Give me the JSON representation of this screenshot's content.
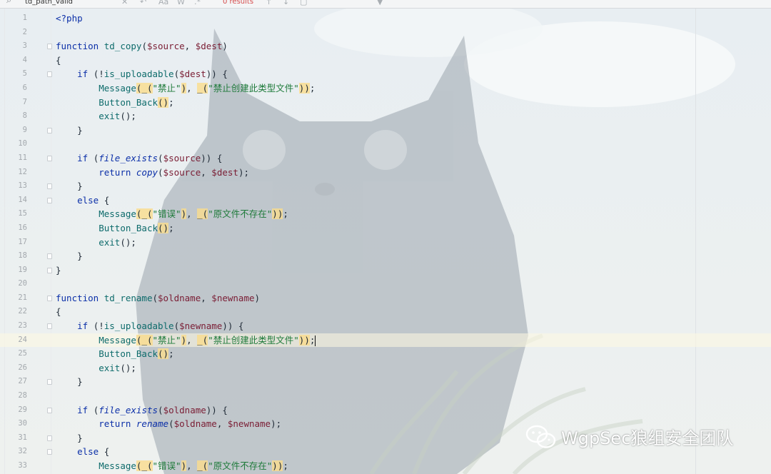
{
  "find_bar": {
    "query": "td_path_valid",
    "results_text": "0 results",
    "icons": [
      "search-icon",
      "close-icon",
      "undo-icon",
      "match-case-icon",
      "whole-word-icon",
      "regex-icon",
      "prev-result-icon",
      "next-result-icon",
      "select-all-icon",
      "filter-icon"
    ]
  },
  "editor": {
    "current_line": 24,
    "line_numbers": [
      "1",
      "2",
      "3",
      "4",
      "5",
      "6",
      "7",
      "8",
      "9",
      "10",
      "11",
      "12",
      "13",
      "14",
      "15",
      "16",
      "17",
      "18",
      "19",
      "20",
      "21",
      "22",
      "23",
      "24",
      "25",
      "26",
      "27",
      "28",
      "29",
      "30",
      "31",
      "32",
      "33"
    ],
    "lines": [
      "<?php",
      "",
      "function td_copy($source, $dest)",
      "{",
      "    if (!is_uploadable($dest)) {",
      "        Message(_(\"禁止\"), _(\"禁止创建此类型文件\"));",
      "        Button_Back();",
      "        exit();",
      "    }",
      "",
      "    if (file_exists($source)) {",
      "        return copy($source, $dest);",
      "    }",
      "    else {",
      "        Message(_(\"错误\"), _(\"原文件不存在\"));",
      "        Button_Back();",
      "        exit();",
      "    }",
      "}",
      "",
      "function td_rename($oldname, $newname)",
      "{",
      "    if (!is_uploadable($newname)) {",
      "        Message(_(\"禁止\"), _(\"禁止创建此类型文件\"));",
      "        Button_Back();",
      "        exit();",
      "    }",
      "",
      "    if (file_exists($oldname)) {",
      "        return rename($oldname, $newname);",
      "    }",
      "    else {",
      "        Message(_(\"错误\"), _(\"原文件不存在\"));"
    ]
  },
  "watermark": {
    "text": "WgpSec狼组安全团队",
    "icon": "wechat-icon"
  },
  "colors": {
    "keyword": "#0b2fa8",
    "function": "#0d6b6b",
    "variable": "#7a1d34",
    "string": "#1e7a3a",
    "highlight": "#fadc8c",
    "line_number": "#a3a8ad"
  }
}
